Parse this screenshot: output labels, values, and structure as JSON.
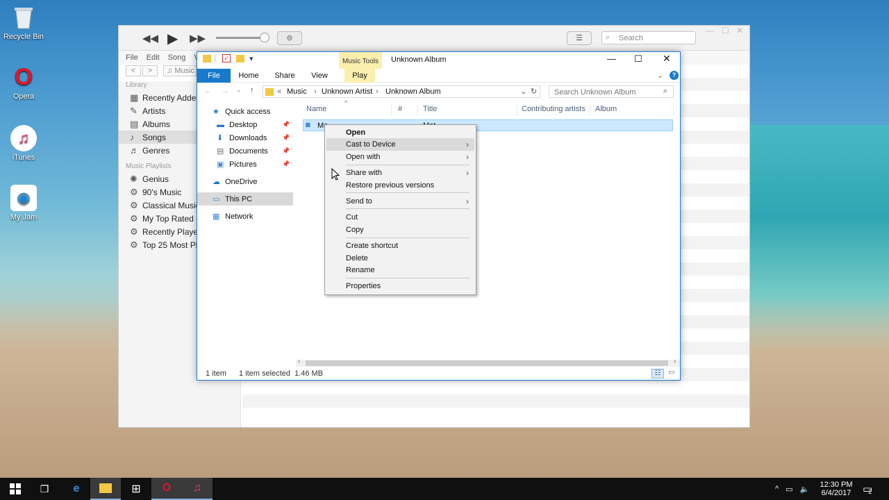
{
  "desktop": {
    "icons": [
      {
        "label": "Recycle Bin",
        "icon": "recycle-bin-icon"
      },
      {
        "label": "Opera",
        "icon": "opera-icon"
      },
      {
        "label": "iTunes",
        "icon": "itunes-icon"
      },
      {
        "label": "My Jam",
        "icon": "my-jam-icon"
      }
    ]
  },
  "itunes": {
    "search_placeholder": "Search",
    "menu": [
      "File",
      "Edit",
      "Song",
      "V"
    ],
    "nav_location": "Music",
    "library_header": "Library",
    "library_items": [
      "Recently Added",
      "Artists",
      "Albums",
      "Songs",
      "Genres"
    ],
    "playlist_header": "Music Playlists",
    "playlist_items": [
      "Genius",
      "90's Music",
      "Classical Music",
      "My Top Rated",
      "Recently Played",
      "Top 25 Most Played"
    ]
  },
  "explorer": {
    "title": "Unknown Album",
    "contextual_group": "Music Tools",
    "ribbon_tabs": [
      "File",
      "Home",
      "Share",
      "View",
      "Play"
    ],
    "breadcrumb": [
      "Music",
      "Unknown Artist",
      "Unknown Album"
    ],
    "breadcrumb_prefix": "«",
    "search_placeholder": "Search Unknown Album",
    "nav": [
      {
        "label": "Quick access",
        "icon": "star-icon"
      },
      {
        "label": "Desktop",
        "icon": "desktop-icon",
        "pinned": true
      },
      {
        "label": "Downloads",
        "icon": "downloads-icon",
        "pinned": true
      },
      {
        "label": "Documents",
        "icon": "documents-icon",
        "pinned": true
      },
      {
        "label": "Pictures",
        "icon": "pictures-icon",
        "pinned": true
      },
      {
        "label": "OneDrive",
        "icon": "onedrive-icon"
      },
      {
        "label": "This PC",
        "icon": "this-pc-icon"
      },
      {
        "label": "Network",
        "icon": "network-icon"
      }
    ],
    "columns": [
      "Name",
      "#",
      "Title",
      "Contributing artists",
      "Album"
    ],
    "file_name": "Mo",
    "file_title": "Mot",
    "status_items": "1 item",
    "status_selected": "1 item selected  1.46 MB"
  },
  "context_menu": {
    "items": [
      "Open",
      "Cast to Device",
      "Open with",
      "Share with",
      "Restore previous versions",
      "Send to",
      "Cut",
      "Copy",
      "Create shortcut",
      "Delete",
      "Rename",
      "Properties"
    ],
    "highlighted": "Cast to Device"
  },
  "taskbar": {
    "time": "12:30 PM",
    "date": "6/4/2017",
    "notification_count": "2"
  }
}
